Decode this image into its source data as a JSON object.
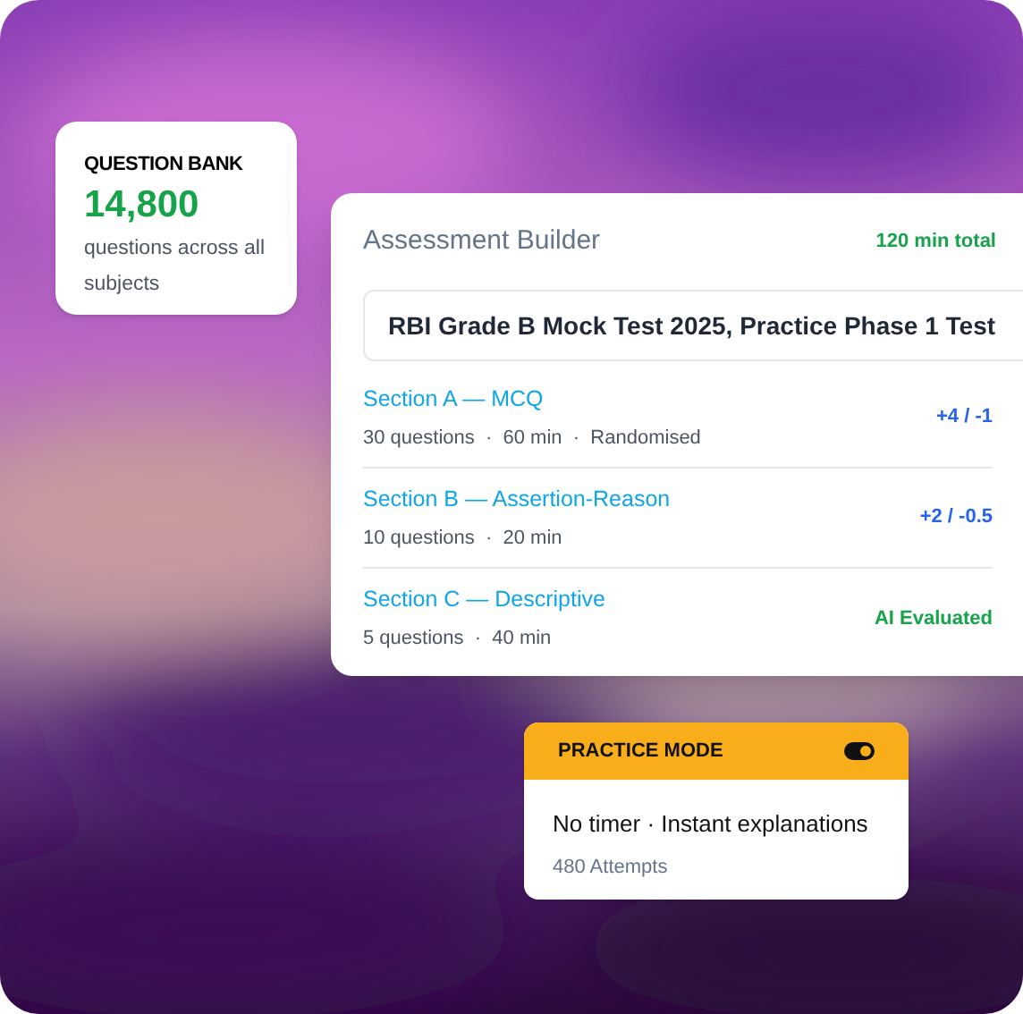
{
  "question_bank": {
    "label": "QUESTION BANK",
    "count": "14,800",
    "caption": "questions across all subjects"
  },
  "builder": {
    "title": "Assessment Builder",
    "total": "120 min total",
    "test_name": "RBI Grade B Mock Test 2025, Practice Phase 1 Test",
    "sections": [
      {
        "name": "Section A — MCQ",
        "meta": "30 questions  ·  60 min  ·  Randomised",
        "badge": "+4 / -1",
        "color": "#2563eb"
      },
      {
        "name": "Section B — Assertion-Reason",
        "meta": "10 questions  ·  20 min",
        "badge": "+2 / -0.5",
        "color": "#2563eb"
      },
      {
        "name": "Section C — Descriptive",
        "meta": "5 questions  ·  40 min",
        "badge": "AI Evaluated",
        "color": "#16a34a"
      }
    ]
  },
  "practice": {
    "label": "PRACTICE MODE",
    "on": true,
    "text": "No timer · Instant explanations",
    "attempts": "480 Attempts"
  }
}
